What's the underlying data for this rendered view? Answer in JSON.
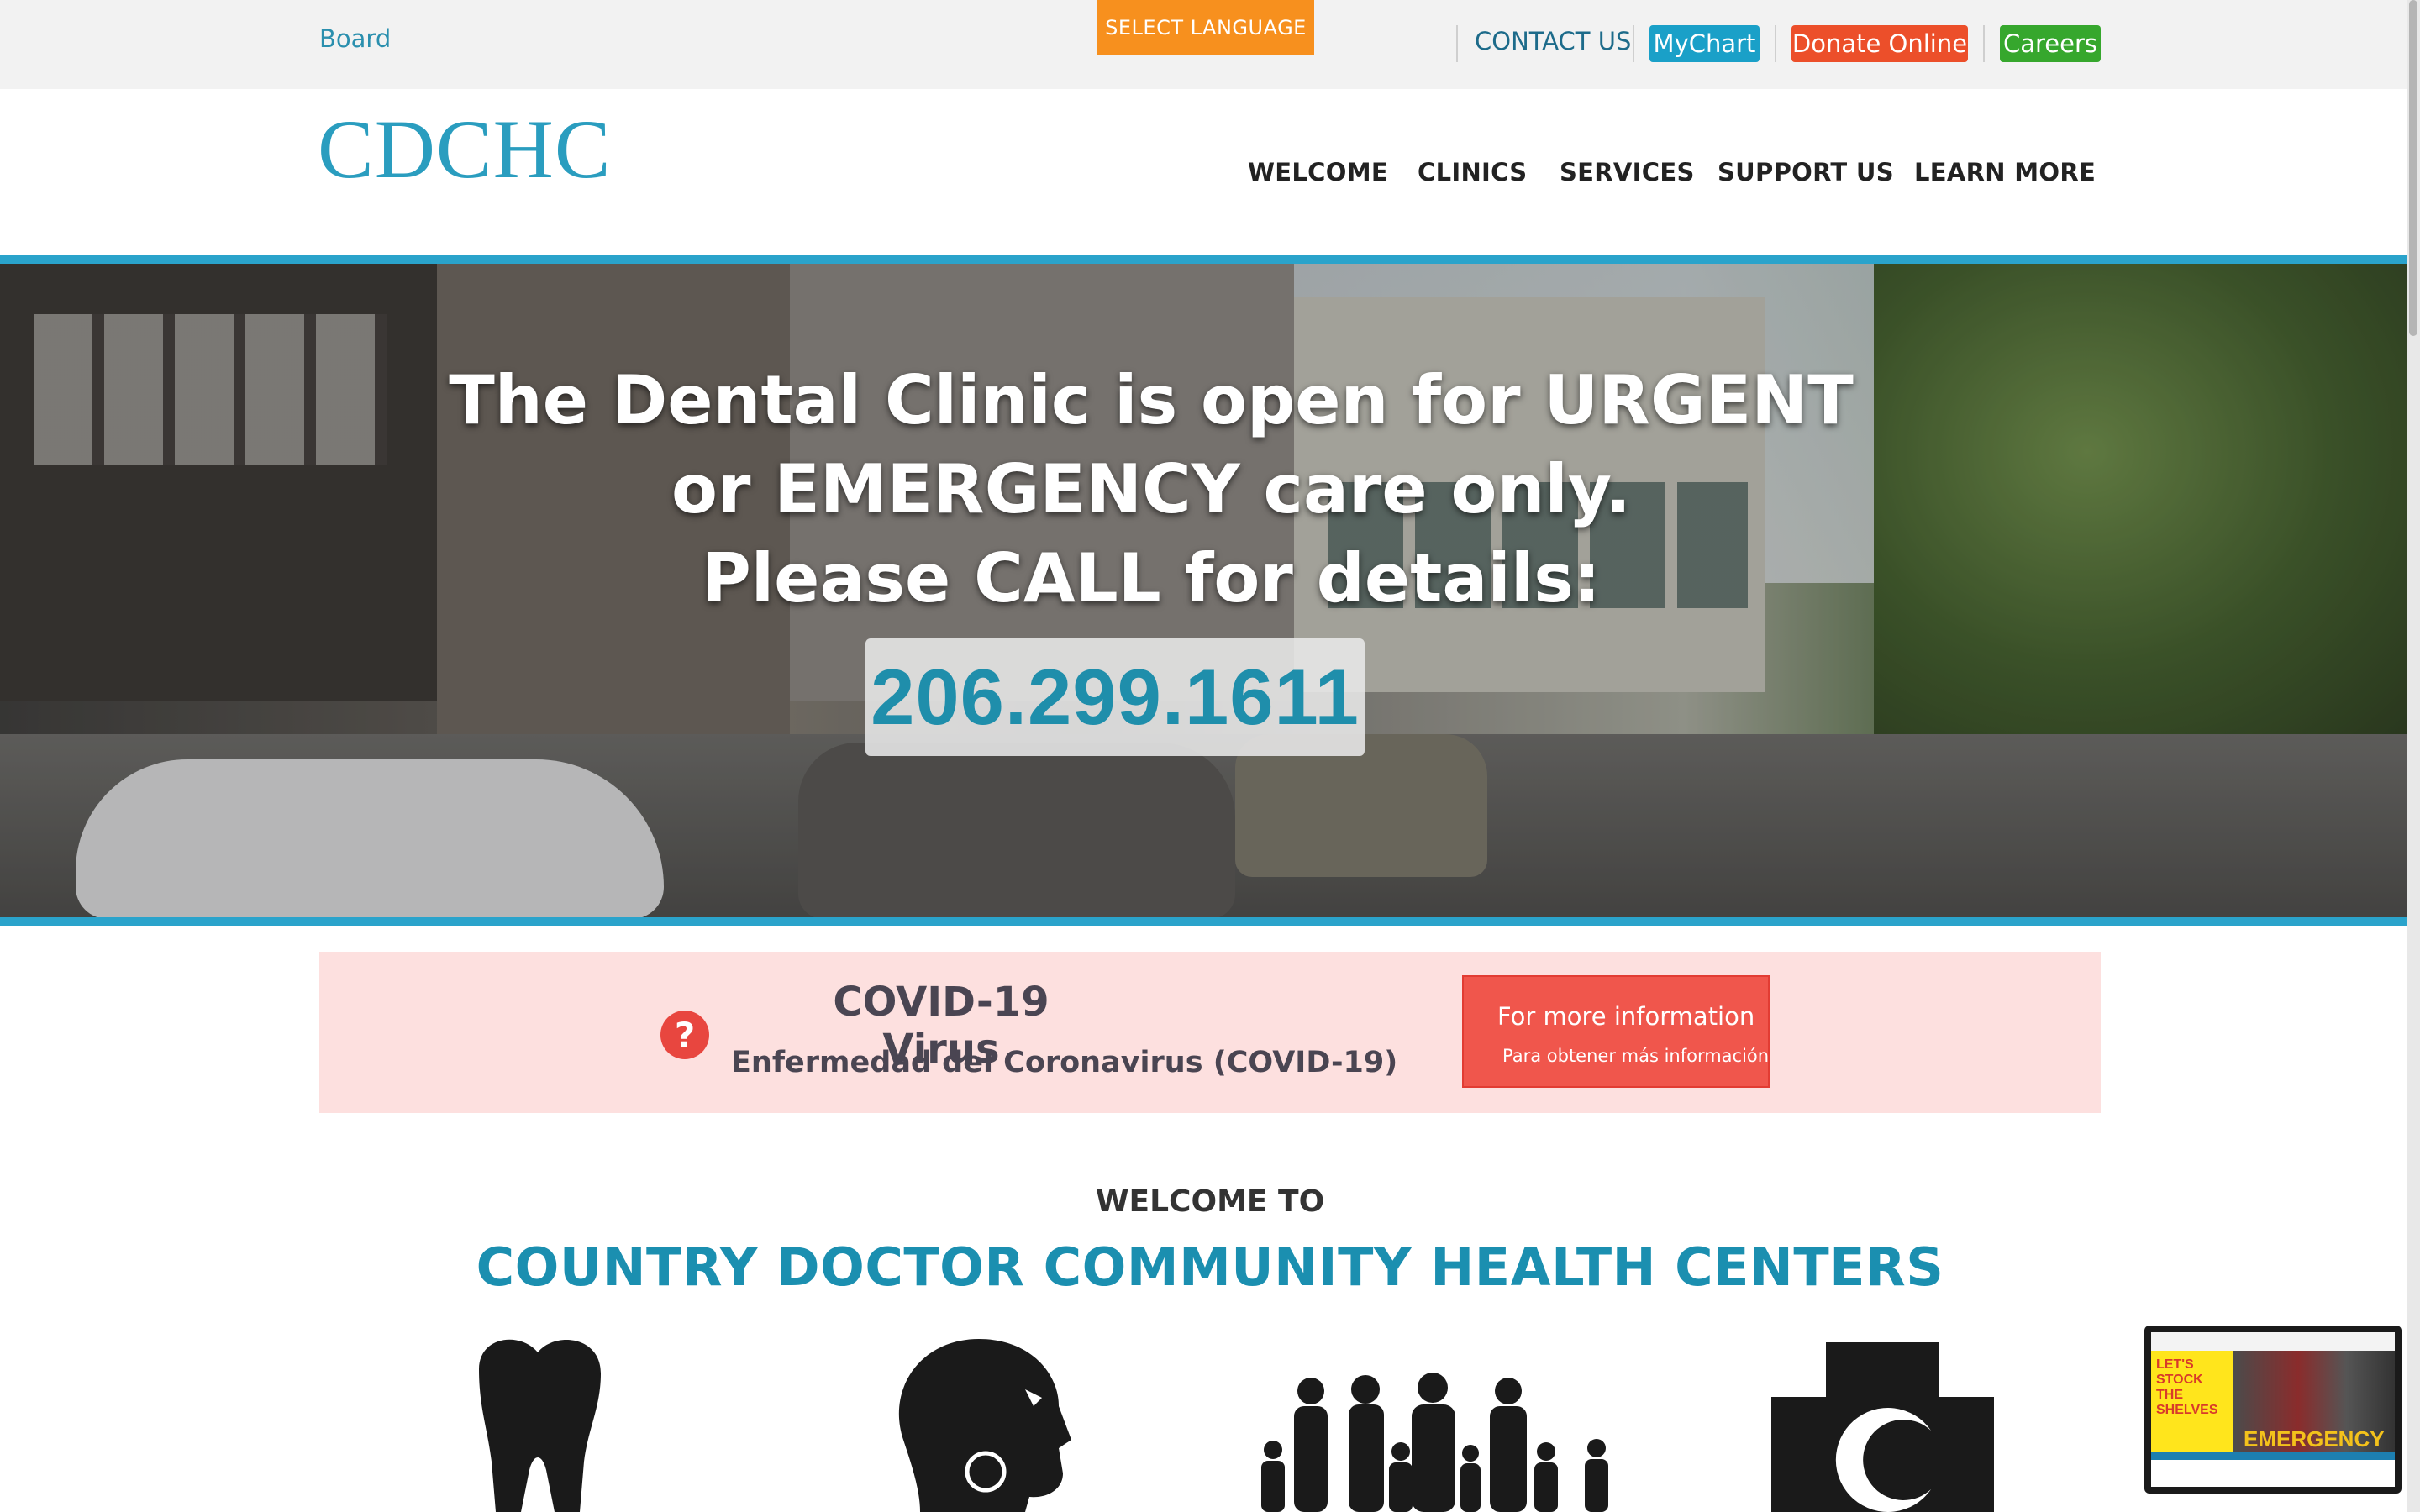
{
  "utility": {
    "board": "Board",
    "select_language": "SELECT LANGUAGE",
    "contact": "CONTACT US",
    "mychart": "MyChart",
    "donate": "Donate Online",
    "careers": "Careers"
  },
  "header": {
    "logo": "CDCHC",
    "nav": [
      "WELCOME",
      "CLINICS",
      "SERVICES",
      "SUPPORT US",
      "LEARN MORE"
    ]
  },
  "hero": {
    "lines": [
      "The Dental Clinic is open for URGENT",
      "or EMERGENCY care only.",
      "Please CALL for details:"
    ],
    "phone": "206.299.1611"
  },
  "covid": {
    "title": "COVID-19 Virus",
    "subtitle": "Enfermedad del Coronavirus (COVID-19)",
    "button_line1": "For more information",
    "button_line2": "Para obtener más información"
  },
  "welcome": {
    "pre": "WELCOME TO",
    "title": "COUNTRY DOCTOR COMMUNITY HEALTH CENTERS"
  },
  "services_icons": [
    "tooth-icon",
    "head-profile-icon",
    "family-icon",
    "medical-cross-icon"
  ],
  "ad": {
    "text": "LET'S STOCK THE SHELVES",
    "overlay": "EMERGENCY"
  },
  "colors": {
    "accent_blue": "#2aa3cb",
    "orange": "#f7901e",
    "donate_red": "#ec4f2a",
    "careers_green": "#36a72d",
    "covid_bg": "#fde0df"
  }
}
